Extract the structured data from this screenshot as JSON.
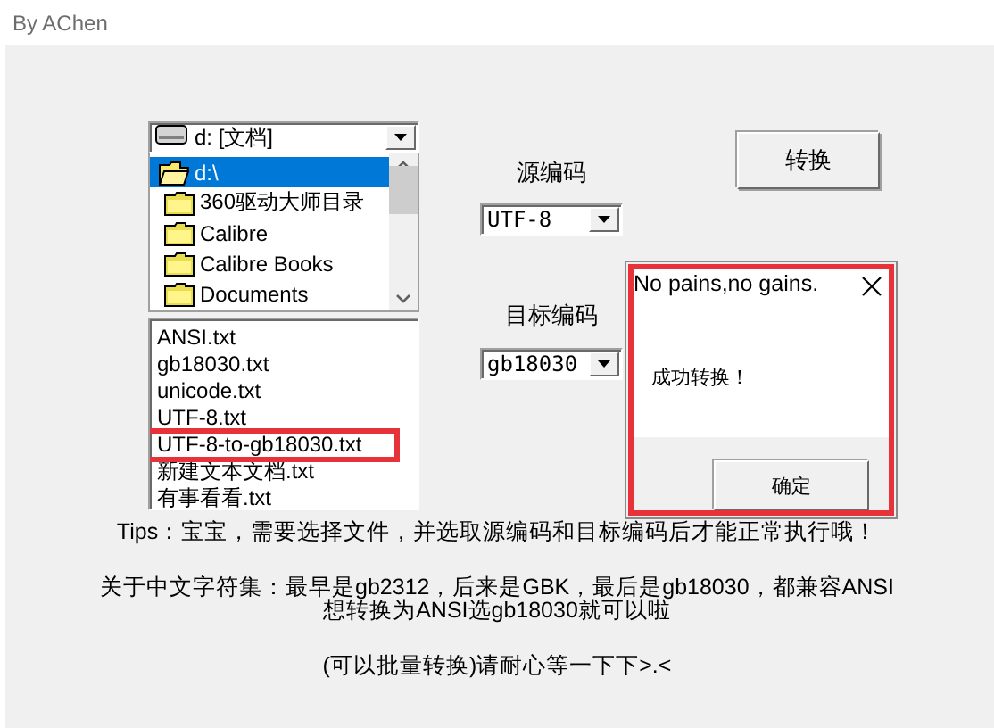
{
  "window": {
    "title": "By AChen"
  },
  "drive_combo": {
    "value": "d: [文档]"
  },
  "folder_list": [
    {
      "name": "d:\\",
      "selected": true,
      "kind": "open"
    },
    {
      "name": "360驱动大师目录",
      "selected": false,
      "kind": "closed"
    },
    {
      "name": "Calibre",
      "selected": false,
      "kind": "closed"
    },
    {
      "name": "Calibre Books",
      "selected": false,
      "kind": "closed"
    },
    {
      "name": "Documents",
      "selected": false,
      "kind": "closed"
    }
  ],
  "file_list": [
    {
      "name": "ANSI.txt",
      "highlighted": false
    },
    {
      "name": "gb18030.txt",
      "highlighted": false
    },
    {
      "name": "unicode.txt",
      "highlighted": false
    },
    {
      "name": "UTF-8.txt",
      "highlighted": false
    },
    {
      "name": "UTF-8-to-gb18030.txt",
      "highlighted": true
    },
    {
      "name": "新建文本文档.txt",
      "highlighted": false
    },
    {
      "name": "有事看看.txt",
      "highlighted": false
    }
  ],
  "source_encoding": {
    "label": "源编码",
    "value": "UTF-8"
  },
  "target_encoding": {
    "label": "目标编码",
    "value": "gb18030"
  },
  "convert_button": "转换",
  "message_box": {
    "title": "No pains,no gains.",
    "message": "成功转换！",
    "button": "确定",
    "highlighted": true
  },
  "notes": [
    "Tips：宝宝，需要选择文件，并选取源编码和目标编码后才能正常执行哦！",
    "关于中文字符集：最早是gb2312，后来是GBK，最后是gb18030，都兼容ANSI",
    "想转换为ANSI选gb18030就可以啦",
    "(可以批量转换)请耐心等一下下>.<"
  ]
}
